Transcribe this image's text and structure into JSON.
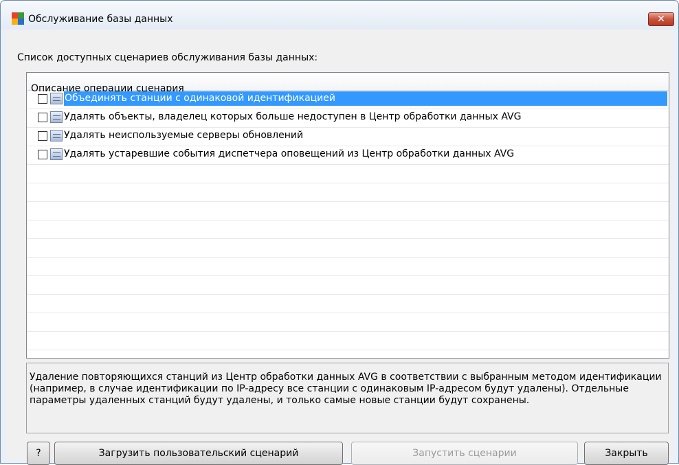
{
  "window": {
    "title": "Обслуживание базы данных",
    "close_label": "✕"
  },
  "list": {
    "caption": "Список доступных сценариев обслуживания базы данных:",
    "column_header": "Описание операции сценария",
    "items": [
      {
        "label": "Объединять станции с одинаковой идентификацией",
        "checked": false,
        "selected": true
      },
      {
        "label": "Удалять объекты, владелец которых больше недоступен в Центр обработки данных AVG",
        "checked": false,
        "selected": false
      },
      {
        "label": "Удалять неиспользуемые серверы обновлений",
        "checked": false,
        "selected": false
      },
      {
        "label": "Удалять устаревшие события диспетчера оповещений из Центр обработки данных AVG",
        "checked": false,
        "selected": false
      }
    ]
  },
  "description": "Удаление повторяющихся станций из Центр обработки данных AVG в соответствии с выбранным методом идентификации (например, в случае идентификации по IP-адресу все станции с одинаковым IP-адресом будут удалены). Отдельные параметры удаленных станций будут удалены, и только самые новые станции будут сохранены.",
  "buttons": {
    "help": "?",
    "load": "Загрузить пользовательский сценарий",
    "run": "Запустить сценарии",
    "close": "Закрыть"
  },
  "colors": {
    "selection": "#3399ff",
    "close_button": "#c9533d"
  }
}
